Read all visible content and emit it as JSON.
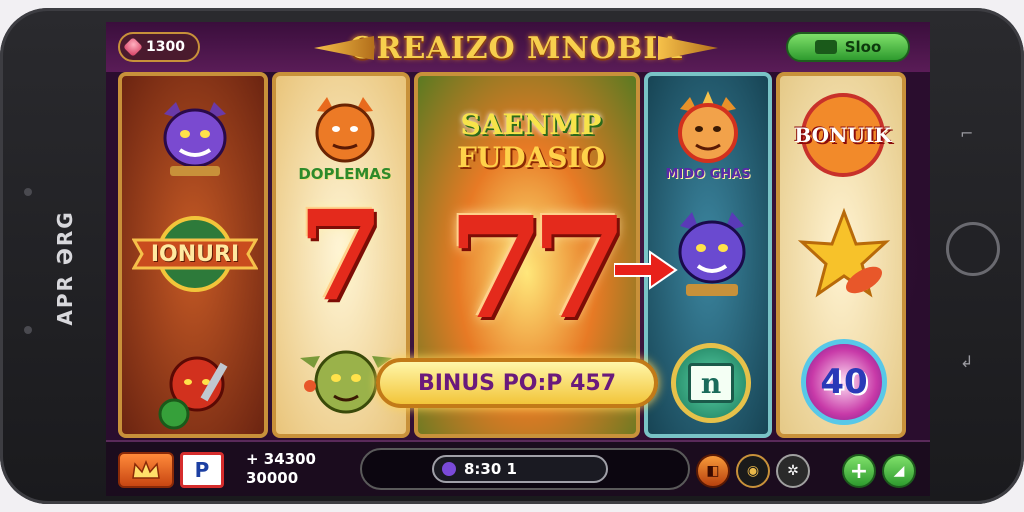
{
  "device": {
    "brand_text": "APR ƏRG"
  },
  "topbar": {
    "coins_value": "1300",
    "title": "OREAIZO MNOBIA",
    "slot_label": "Sloo"
  },
  "reels": {
    "r1": {
      "bonus_label": "IONURI"
    },
    "r2": {
      "top_label": "DOPLEMAS"
    },
    "r3": {
      "top_title_line1": "SAENMP",
      "top_title_line2": "FUDASIO"
    },
    "r4": {
      "top_label": "MIDO GHAS",
      "coin_letter": "n"
    },
    "r5": {
      "top_label": "BONUIK",
      "chip_value": "40"
    }
  },
  "bonus_banner": "BINUS PO:P 457",
  "bottombar": {
    "bet_line1": "+ 34300",
    "bet_line2": "30000",
    "spin_value": "8:30 1",
    "blue_btn_label": "P"
  },
  "icons": {
    "coins": "gem-icon",
    "slot": "slot-icon",
    "menu": "crown-icon",
    "info": "info-icon",
    "paytable": "paytable-icon",
    "settings": "gear-icon",
    "add": "plus-icon",
    "go": "arrow-icon"
  }
}
